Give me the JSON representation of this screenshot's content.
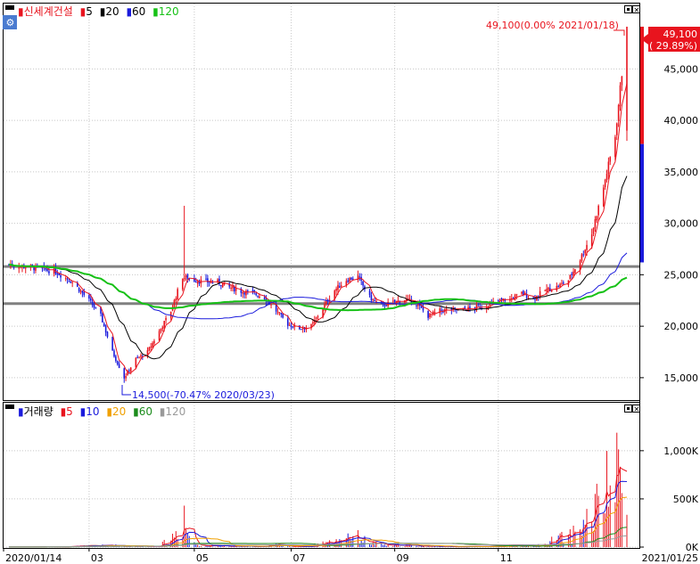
{
  "price_panel": {
    "stock_name": "신세계건설",
    "ma_legend": [
      {
        "label": "5",
        "color": "#e8141e"
      },
      {
        "label": "20",
        "color": "#000000"
      },
      {
        "label": "60",
        "color": "#1a1adc"
      },
      {
        "label": "120",
        "color": "#16c116"
      }
    ],
    "high_annotation": "49,100(0.00% 2021/01/18)",
    "low_annotation": "14,500(-70.47% 2020/03/23)",
    "current_price": "49,100",
    "current_change": "( 29.89%)"
  },
  "volume_panel": {
    "title": "거래량",
    "ma_legend": [
      {
        "label": "5",
        "color": "#e8141e"
      },
      {
        "label": "10",
        "color": "#1a1adc"
      },
      {
        "label": "20",
        "color": "#f0a000"
      },
      {
        "label": "60",
        "color": "#1c8c1c"
      },
      {
        "label": "120",
        "color": "#9a9a9a"
      }
    ]
  },
  "x_axis_labels": [
    "2020/01/14",
    "03",
    "05",
    "07",
    "09",
    "11",
    "2021/01/25"
  ],
  "colors": {
    "up": "#e8141e",
    "down": "#1a1adc",
    "frame": "#000000",
    "grid": "#c8c8c8"
  },
  "chart_data": {
    "type": "candlestick",
    "title": "신세계건설",
    "price_axis": {
      "ticks": [
        "15,000",
        "20,000",
        "25,000",
        "30,000",
        "35,000",
        "40,000",
        "45,000"
      ],
      "ylim": [
        13000,
        51000
      ]
    },
    "volume_axis": {
      "ticks": [
        "0K",
        "500K",
        "1,000K"
      ],
      "ylim": [
        0,
        1350000
      ]
    },
    "horizontal_lines": [
      25800,
      22200
    ],
    "right_price_bar": {
      "top": 49100,
      "mid": 37700,
      "bottom": 26200
    },
    "close_series": [
      [
        "2020-01-14",
        26000
      ],
      [
        "2020-01-28",
        25700
      ],
      [
        "2020-02-11",
        25300
      ],
      [
        "2020-02-21",
        24300
      ],
      [
        "2020-03-02",
        22500
      ],
      [
        "2020-03-09",
        21000
      ],
      [
        "2020-03-16",
        17500
      ],
      [
        "2020-03-23",
        15000
      ],
      [
        "2020-03-30",
        16800
      ],
      [
        "2020-04-06",
        17500
      ],
      [
        "2020-04-13",
        19500
      ],
      [
        "2020-04-20",
        21500
      ],
      [
        "2020-04-27",
        24800
      ],
      [
        "2020-05-04",
        24500
      ],
      [
        "2020-05-11",
        24300
      ],
      [
        "2020-05-18",
        24300
      ],
      [
        "2020-05-25",
        23800
      ],
      [
        "2020-06-01",
        23400
      ],
      [
        "2020-06-08",
        23200
      ],
      [
        "2020-06-15",
        22800
      ],
      [
        "2020-06-22",
        21500
      ],
      [
        "2020-06-29",
        20200
      ],
      [
        "2020-07-06",
        19800
      ],
      [
        "2020-07-13",
        20000
      ],
      [
        "2020-07-20",
        21800
      ],
      [
        "2020-07-27",
        23500
      ],
      [
        "2020-08-03",
        24500
      ],
      [
        "2020-08-10",
        24800
      ],
      [
        "2020-08-17",
        22800
      ],
      [
        "2020-08-24",
        22000
      ],
      [
        "2020-08-31",
        22300
      ],
      [
        "2020-09-07",
        22600
      ],
      [
        "2020-09-14",
        22200
      ],
      [
        "2020-09-21",
        21000
      ],
      [
        "2020-09-28",
        21500
      ],
      [
        "2020-10-05",
        21600
      ],
      [
        "2020-10-12",
        21600
      ],
      [
        "2020-10-19",
        21800
      ],
      [
        "2020-10-26",
        22000
      ],
      [
        "2020-11-02",
        22500
      ],
      [
        "2020-11-09",
        22600
      ],
      [
        "2020-11-16",
        23200
      ],
      [
        "2020-11-23",
        22700
      ],
      [
        "2020-11-30",
        23500
      ],
      [
        "2020-12-07",
        23800
      ],
      [
        "2020-12-14",
        24500
      ],
      [
        "2020-12-21",
        26500
      ],
      [
        "2020-12-28",
        29000
      ],
      [
        "2021-01-04",
        33500
      ],
      [
        "2021-01-11",
        38500
      ],
      [
        "2021-01-18",
        49100
      ]
    ],
    "volume_series": [
      [
        "2020-01-14",
        4000
      ],
      [
        "2020-01-28",
        6000
      ],
      [
        "2020-02-11",
        8000
      ],
      [
        "2020-02-21",
        12000
      ],
      [
        "2020-03-02",
        20000
      ],
      [
        "2020-03-09",
        25000
      ],
      [
        "2020-03-16",
        30000
      ],
      [
        "2020-03-23",
        22000
      ],
      [
        "2020-03-30",
        18000
      ],
      [
        "2020-04-06",
        15000
      ],
      [
        "2020-04-13",
        20000
      ],
      [
        "2020-04-20",
        140000
      ],
      [
        "2020-04-27",
        430000
      ],
      [
        "2020-05-04",
        60000
      ],
      [
        "2020-05-11",
        30000
      ],
      [
        "2020-05-18",
        20000
      ],
      [
        "2020-05-25",
        15000
      ],
      [
        "2020-06-01",
        13000
      ],
      [
        "2020-06-08",
        12000
      ],
      [
        "2020-06-15",
        15000
      ],
      [
        "2020-06-22",
        40000
      ],
      [
        "2020-06-29",
        15000
      ],
      [
        "2020-07-06",
        10000
      ],
      [
        "2020-07-13",
        20000
      ],
      [
        "2020-07-20",
        80000
      ],
      [
        "2020-07-27",
        80000
      ],
      [
        "2020-08-03",
        230000
      ],
      [
        "2020-08-10",
        170000
      ],
      [
        "2020-08-17",
        80000
      ],
      [
        "2020-08-24",
        40000
      ],
      [
        "2020-08-31",
        25000
      ],
      [
        "2020-09-07",
        40000
      ],
      [
        "2020-09-14",
        15000
      ],
      [
        "2020-09-21",
        25000
      ],
      [
        "2020-09-28",
        10000
      ],
      [
        "2020-10-05",
        10000
      ],
      [
        "2020-10-12",
        8000
      ],
      [
        "2020-10-19",
        12000
      ],
      [
        "2020-10-26",
        10000
      ],
      [
        "2020-11-02",
        15000
      ],
      [
        "2020-11-09",
        25000
      ],
      [
        "2020-11-16",
        30000
      ],
      [
        "2020-11-23",
        20000
      ],
      [
        "2020-11-30",
        40000
      ],
      [
        "2020-12-07",
        160000
      ],
      [
        "2020-12-14",
        150000
      ],
      [
        "2020-12-21",
        350000
      ],
      [
        "2020-12-28",
        530000
      ],
      [
        "2021-01-04",
        880000
      ],
      [
        "2021-01-11",
        1150000
      ],
      [
        "2021-01-18",
        1280000
      ]
    ]
  }
}
